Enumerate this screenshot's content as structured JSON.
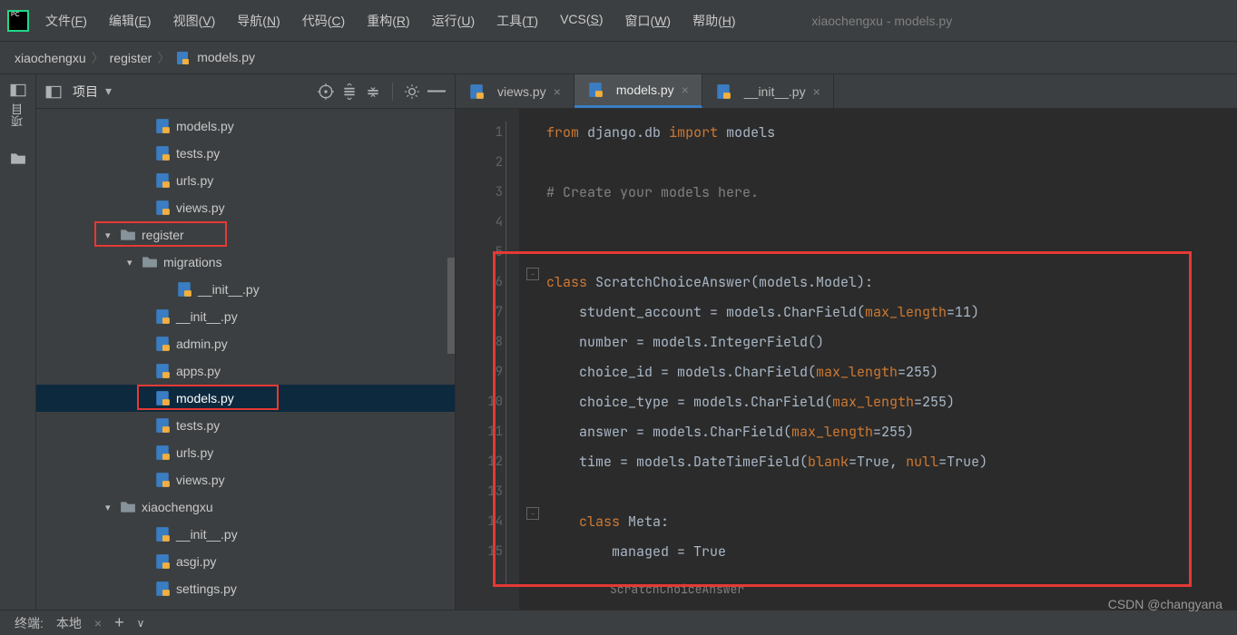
{
  "window": {
    "title": "xiaochengxu - models.py"
  },
  "menu": [
    {
      "label": "文件",
      "accel": "F"
    },
    {
      "label": "编辑",
      "accel": "E"
    },
    {
      "label": "视图",
      "accel": "V"
    },
    {
      "label": "导航",
      "accel": "N"
    },
    {
      "label": "代码",
      "accel": "C"
    },
    {
      "label": "重构",
      "accel": "R"
    },
    {
      "label": "运行",
      "accel": "U"
    },
    {
      "label": "工具",
      "accel": "T"
    },
    {
      "label": "VCS",
      "accel": "S"
    },
    {
      "label": "窗口",
      "accel": "W"
    },
    {
      "label": "帮助",
      "accel": "H"
    }
  ],
  "breadcrumbs": {
    "c0": "xiaochengxu",
    "c1": "register",
    "c2": "models.py"
  },
  "sidebar": {
    "title": "项目",
    "gutter_label": "项目",
    "items": [
      {
        "label": "models.py",
        "indent": 130,
        "type": "py"
      },
      {
        "label": "tests.py",
        "indent": 130,
        "type": "py"
      },
      {
        "label": "urls.py",
        "indent": 130,
        "type": "py"
      },
      {
        "label": "views.py",
        "indent": 130,
        "type": "py"
      },
      {
        "label": "register",
        "indent": 76,
        "type": "folder",
        "chev": "down"
      },
      {
        "label": "migrations",
        "indent": 100,
        "type": "folder",
        "chev": "down"
      },
      {
        "label": "__init__.py",
        "indent": 154,
        "type": "py"
      },
      {
        "label": "__init__.py",
        "indent": 130,
        "type": "py"
      },
      {
        "label": "admin.py",
        "indent": 130,
        "type": "py"
      },
      {
        "label": "apps.py",
        "indent": 130,
        "type": "py"
      },
      {
        "label": "models.py",
        "indent": 130,
        "type": "py",
        "selected": true
      },
      {
        "label": "tests.py",
        "indent": 130,
        "type": "py"
      },
      {
        "label": "urls.py",
        "indent": 130,
        "type": "py"
      },
      {
        "label": "views.py",
        "indent": 130,
        "type": "py"
      },
      {
        "label": "xiaochengxu",
        "indent": 76,
        "type": "folder",
        "chev": "down"
      },
      {
        "label": "__init__.py",
        "indent": 130,
        "type": "py"
      },
      {
        "label": "asgi.py",
        "indent": 130,
        "type": "py"
      },
      {
        "label": "settings.py",
        "indent": 130,
        "type": "py"
      }
    ]
  },
  "tabs": [
    {
      "label": "views.py",
      "active": false
    },
    {
      "label": "models.py",
      "active": true
    },
    {
      "label": "__init__.py",
      "active": false
    }
  ],
  "code": {
    "lines": [
      "1",
      "2",
      "3",
      "4",
      "5",
      "6",
      "7",
      "8",
      "9",
      "10",
      "11",
      "12",
      "13",
      "14",
      "15"
    ],
    "l1_from": "from",
    "l1_pkg": "django.db",
    "l1_import": "import",
    "l1_mod": "models",
    "l3_comment": "# Create your models here.",
    "l6_class": "class",
    "l6_name": "ScratchChoiceAnswer(models.Model):",
    "l7": "student_account = models.CharField(",
    "l7_param": "max_length",
    "l7_end": "=11)",
    "l8": "number = models.IntegerField()",
    "l9": "choice_id = models.CharField(",
    "l9_param": "max_length",
    "l9_end": "=255)",
    "l10": "choice_type = models.CharField(",
    "l10_param": "max_length",
    "l10_end": "=255)",
    "l11": "answer = models.CharField(",
    "l11_param": "max_length",
    "l11_end": "=255)",
    "l12": "time = models.DateTimeField(",
    "l12_p1": "blank",
    "l12_t": "=True, ",
    "l12_p2": "null",
    "l12_t2": "=True)",
    "l14_class": "class",
    "l14_name": "Meta:",
    "l15": "managed = True",
    "crumb": "ScratchChoiceAnswer"
  },
  "bottom": {
    "label": "终端:",
    "local": "本地"
  },
  "watermark": "CSDN @changyana"
}
